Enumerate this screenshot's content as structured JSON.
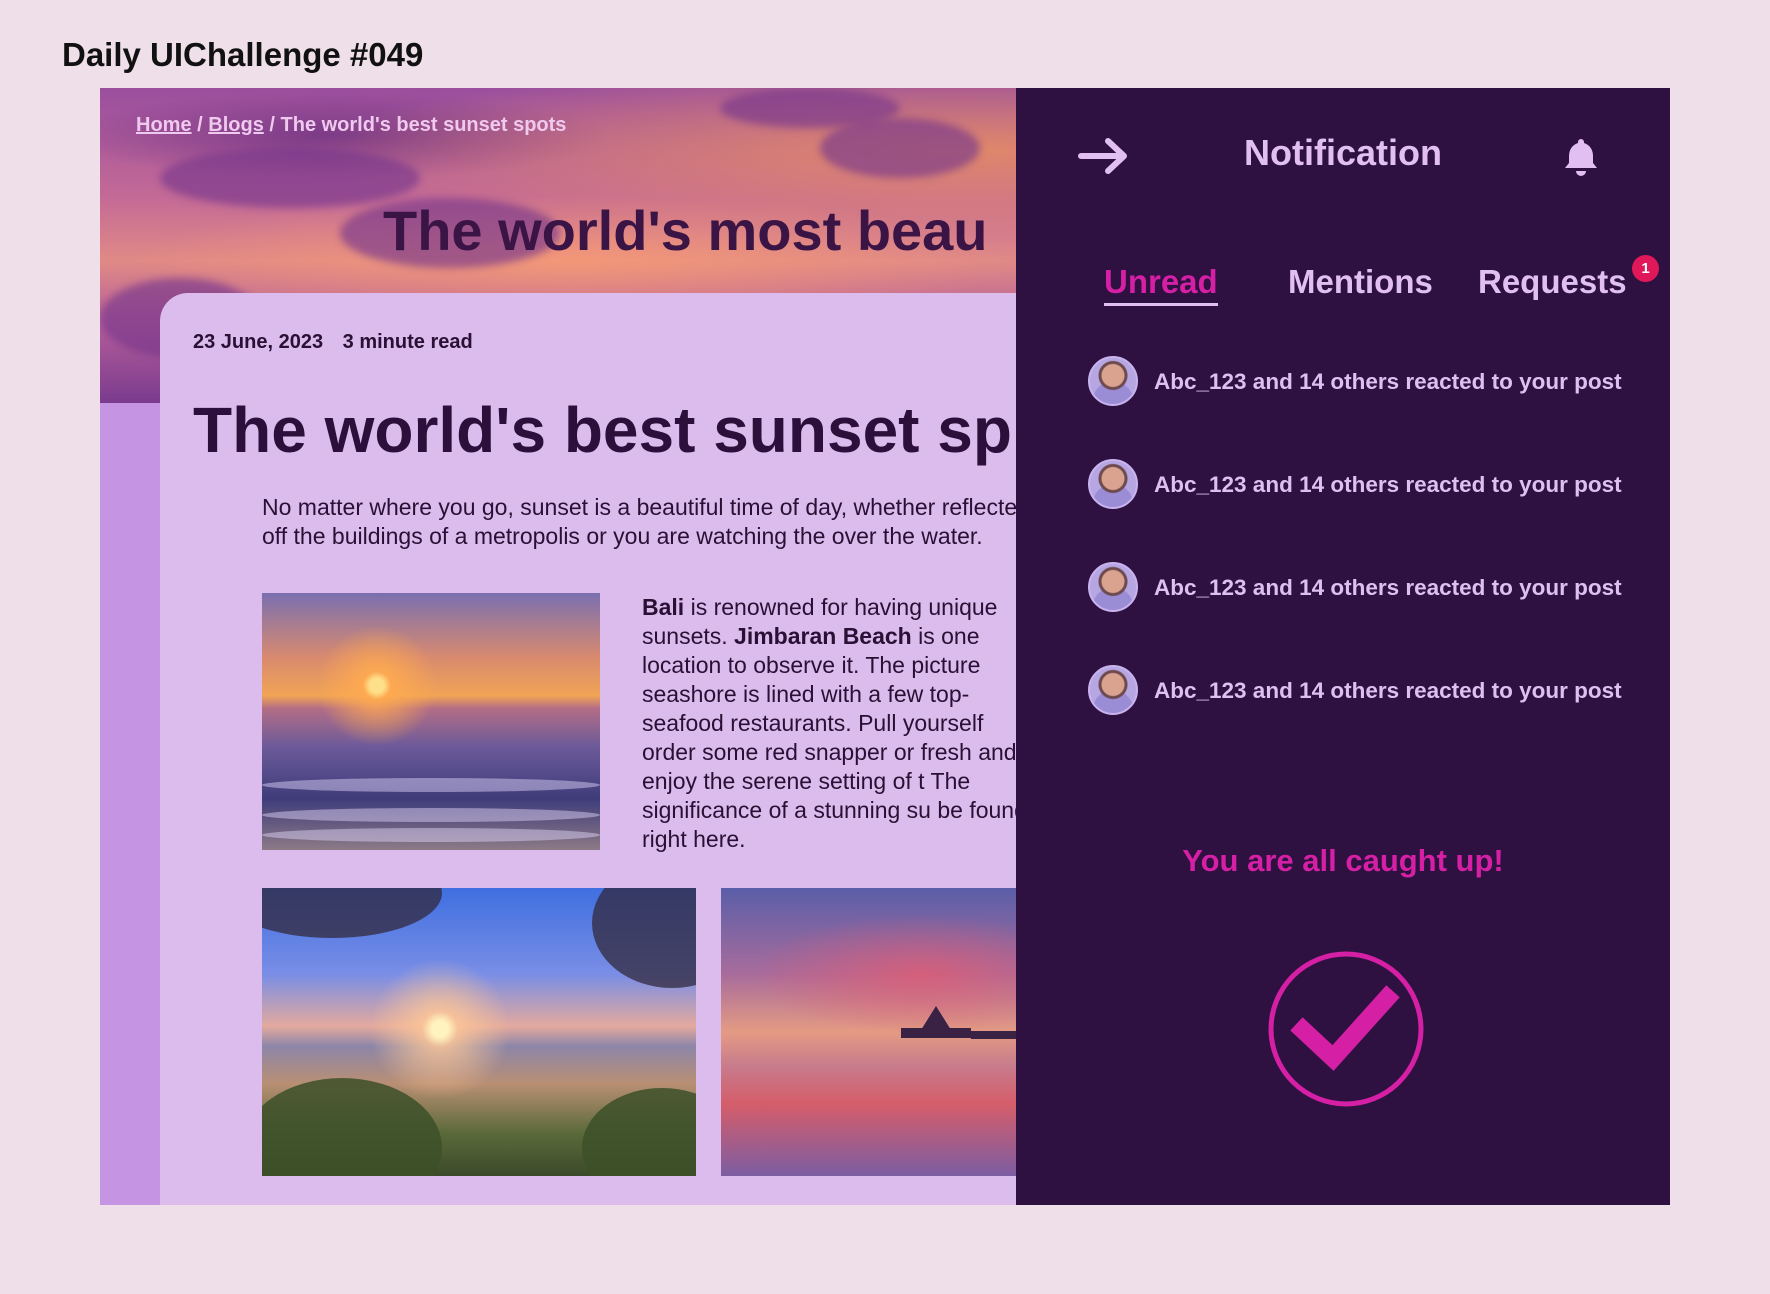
{
  "page": {
    "challenge_title": "Daily UIChallenge #049"
  },
  "breadcrumb": {
    "home": "Home",
    "separator": "/",
    "blogs": "Blogs",
    "current": "The world's best sunset spots"
  },
  "hero": {
    "title": "The world's most beau"
  },
  "article": {
    "date": "23 June, 2023",
    "read_time": "3 minute read",
    "title": "The world's best sunset sp",
    "intro": "No matter where you go, sunset is a beautiful time of day, whether reflected off the buildings of a metropolis or you are watching the over the water.",
    "body_bold_1": "Bali",
    "body_text_1": " is renowned for having unique sunsets. ",
    "body_bold_2": "Jimbaran Beach",
    "body_text_2": " is one location to observe it. The picture seashore is lined with a few top- seafood restaurants. Pull yourself order some red snapper or fresh and enjoy the serene setting of t The significance of a stunning su be found right here."
  },
  "notifications": {
    "title": "Notification",
    "icons": {
      "close": "arrow-right-icon",
      "bell": "bell-icon",
      "done": "check-circle-icon"
    },
    "tabs": [
      {
        "label": "Unread",
        "active": true
      },
      {
        "label": "Mentions",
        "active": false
      },
      {
        "label": "Requests",
        "active": false,
        "badge": "1"
      }
    ],
    "items": [
      {
        "text": "Abc_123 and 14 others reacted to your post"
      },
      {
        "text": "Abc_123 and 14 others reacted to your post"
      },
      {
        "text": "Abc_123 and 14 others reacted to your post"
      },
      {
        "text": "Abc_123 and 14 others reacted to your post"
      }
    ],
    "empty_message": "You are all caught up!"
  },
  "colors": {
    "background": "#efdfe8",
    "panel": "#2e1140",
    "accent": "#d51fa4",
    "panel_text": "#e2bff3",
    "badge": "#e0185a",
    "card": "#dbbcec"
  }
}
